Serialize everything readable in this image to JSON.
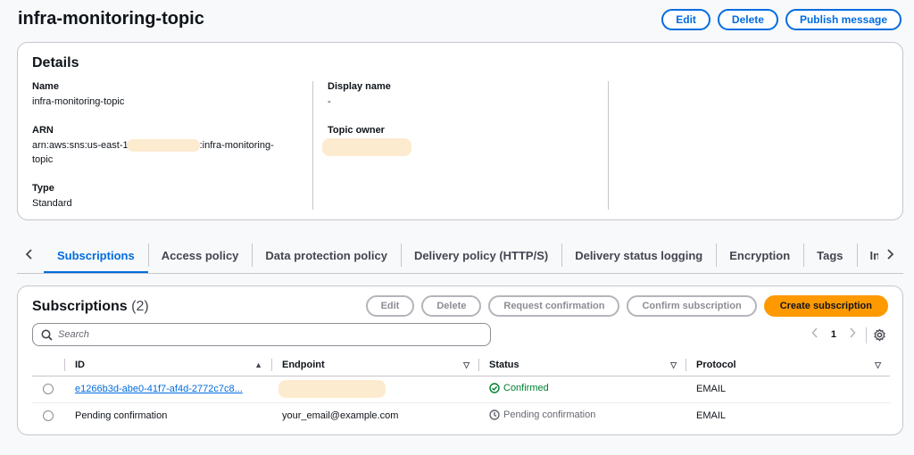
{
  "header": {
    "title": "infra-monitoring-topic",
    "actions": {
      "edit": "Edit",
      "delete": "Delete",
      "publish": "Publish message"
    }
  },
  "details": {
    "heading": "Details",
    "name_label": "Name",
    "name_value": "infra-monitoring-topic",
    "arn_label": "ARN",
    "arn_prefix": "arn:aws:sns:us-east-1",
    "arn_suffix": ":infra-monitoring-",
    "arn_suffix2": "topic",
    "type_label": "Type",
    "type_value": "Standard",
    "display_name_label": "Display name",
    "display_name_value": "-",
    "topic_owner_label": "Topic owner"
  },
  "tabs": [
    {
      "label": "Subscriptions",
      "active": true
    },
    {
      "label": "Access policy"
    },
    {
      "label": "Data protection policy"
    },
    {
      "label": "Delivery policy (HTTP/S)"
    },
    {
      "label": "Delivery status logging"
    },
    {
      "label": "Encryption"
    },
    {
      "label": "Tags"
    },
    {
      "label": "Integrations"
    }
  ],
  "subscriptions": {
    "heading": "Subscriptions",
    "count": "(2)",
    "actions": {
      "edit": "Edit",
      "delete": "Delete",
      "request_confirmation": "Request confirmation",
      "confirm_subscription": "Confirm subscription",
      "create": "Create subscription"
    },
    "search_placeholder": "Search",
    "page": "1",
    "columns": {
      "id": "ID",
      "endpoint": "Endpoint",
      "status": "Status",
      "protocol": "Protocol"
    },
    "rows": [
      {
        "id": "e1266b3d-abe0-41f7-af4d-2772c7c8...",
        "endpoint": "",
        "status": "Confirmed",
        "protocol": "EMAIL"
      },
      {
        "id": "Pending confirmation",
        "endpoint": "your_email@example.com",
        "status": "Pending confirmation",
        "protocol": "EMAIL"
      }
    ]
  },
  "colors": {
    "accent": "#006ce0",
    "primary": "#ff9900",
    "success": "#00802f"
  }
}
